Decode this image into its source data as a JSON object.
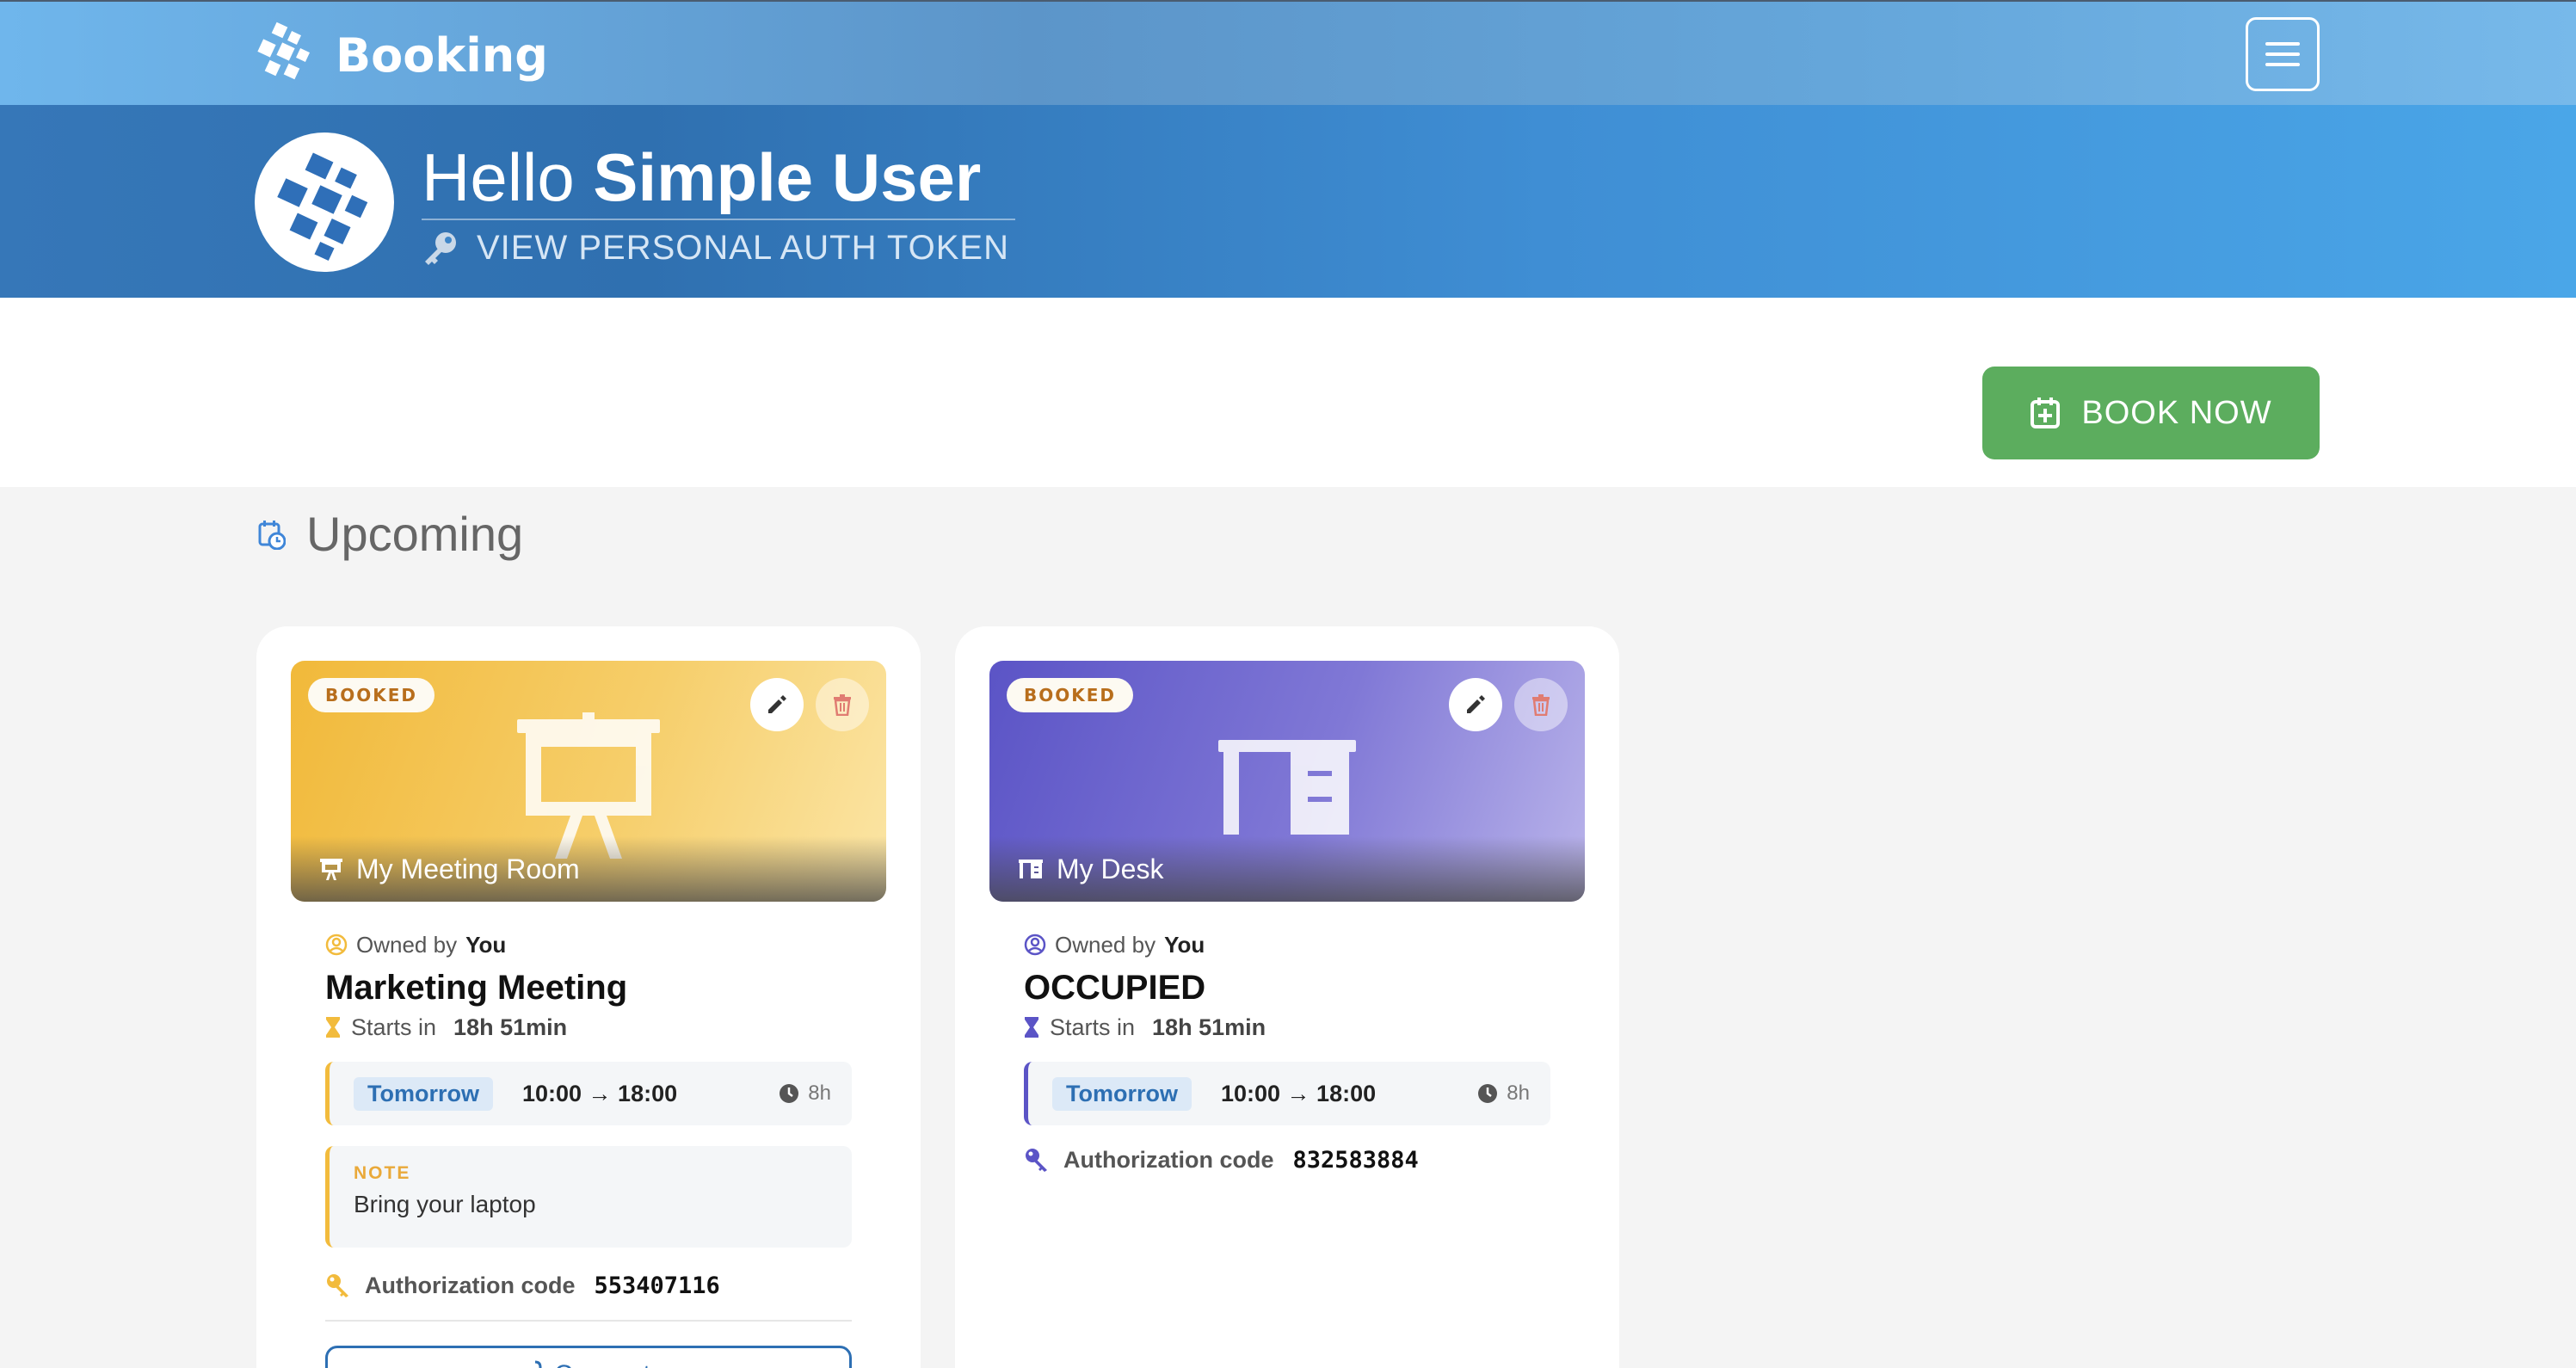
{
  "header": {
    "brand": "Booking"
  },
  "hero": {
    "greeting_prefix": "Hello",
    "user_name": "Simple User",
    "token_link": "VIEW PERSONAL AUTH TOKEN"
  },
  "actions": {
    "book_now": "BOOK NOW"
  },
  "section": {
    "title": "Upcoming"
  },
  "bookings": [
    {
      "status": "BOOKED",
      "resource_name": "My Meeting Room",
      "resource_icon": "presentation-board-icon",
      "owned_prefix": "Owned by",
      "owner": "You",
      "title": "Marketing Meeting",
      "starts_prefix": "Starts in",
      "starts_in": "18h 51min",
      "day": "Tomorrow",
      "time_range": "10:00 → 18:00",
      "duration": "8h",
      "note_label": "NOTE",
      "note": "Bring your laptop",
      "auth_label": "Authorization code",
      "auth_code": "553407116",
      "connect_label": "Connect",
      "accent": "#f2bb3c"
    },
    {
      "status": "BOOKED",
      "resource_name": "My Desk",
      "resource_icon": "desk-icon",
      "owned_prefix": "Owned by",
      "owner": "You",
      "title": "OCCUPIED",
      "starts_prefix": "Starts in",
      "starts_in": "18h 51min",
      "day": "Tomorrow",
      "time_range": "10:00 → 18:00",
      "duration": "8h",
      "auth_label": "Authorization code",
      "auth_code": "832583884",
      "accent": "#5b54c6"
    }
  ],
  "colors": {
    "primary_blue": "#3f8ed4",
    "success_green": "#5cad5e",
    "meeting_accent": "#f2bb3c",
    "desk_accent": "#5b54c6"
  }
}
